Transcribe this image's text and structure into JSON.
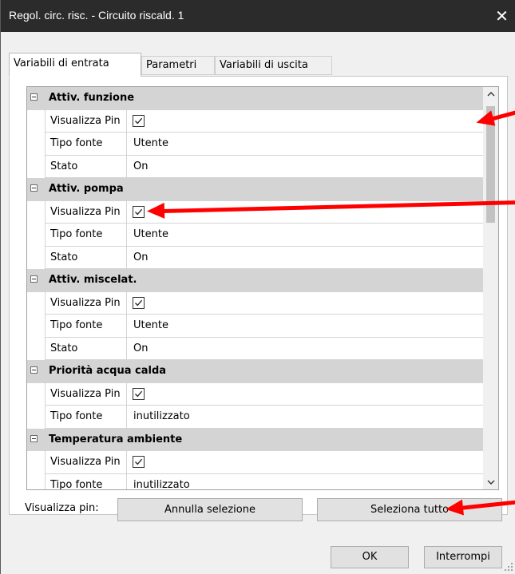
{
  "window": {
    "title": "Regol. circ. risc. - Circuito riscald. 1",
    "close_glyph": "✕"
  },
  "tabs": [
    {
      "label": "Variabili di entrata",
      "active": true
    },
    {
      "label": "Parametri",
      "active": false
    },
    {
      "label": "Variabili di uscita",
      "active": false
    }
  ],
  "groups": [
    {
      "name": "Attiv. funzione",
      "props": [
        {
          "label": "Visualizza Pin",
          "type": "checkbox",
          "checked": true
        },
        {
          "label": "Tipo fonte",
          "value": "Utente"
        },
        {
          "label": "Stato",
          "value": "On"
        }
      ]
    },
    {
      "name": "Attiv. pompa",
      "props": [
        {
          "label": "Visualizza Pin",
          "type": "checkbox",
          "checked": true
        },
        {
          "label": "Tipo fonte",
          "value": "Utente"
        },
        {
          "label": "Stato",
          "value": "On"
        }
      ]
    },
    {
      "name": "Attiv. miscelat.",
      "props": [
        {
          "label": "Visualizza Pin",
          "type": "checkbox",
          "checked": true
        },
        {
          "label": "Tipo fonte",
          "value": "Utente"
        },
        {
          "label": "Stato",
          "value": "On"
        }
      ]
    },
    {
      "name": "Priorità acqua calda",
      "props": [
        {
          "label": "Visualizza Pin",
          "type": "checkbox",
          "checked": true
        },
        {
          "label": "Tipo fonte",
          "value": "inutilizzato"
        }
      ]
    },
    {
      "name": "Temperatura ambiente",
      "props": [
        {
          "label": "Visualizza Pin",
          "type": "checkbox",
          "checked": true
        },
        {
          "label": "Tipo fonte",
          "value": "inutilizzato"
        }
      ]
    }
  ],
  "pin_row": {
    "label": "Visualizza pin:",
    "deselect_label": "Annulla selezione",
    "select_all_label": "Seleziona tutto"
  },
  "footer": {
    "ok_label": "OK",
    "cancel_label": "Interrompi"
  },
  "annotation_color": "#ff0000"
}
